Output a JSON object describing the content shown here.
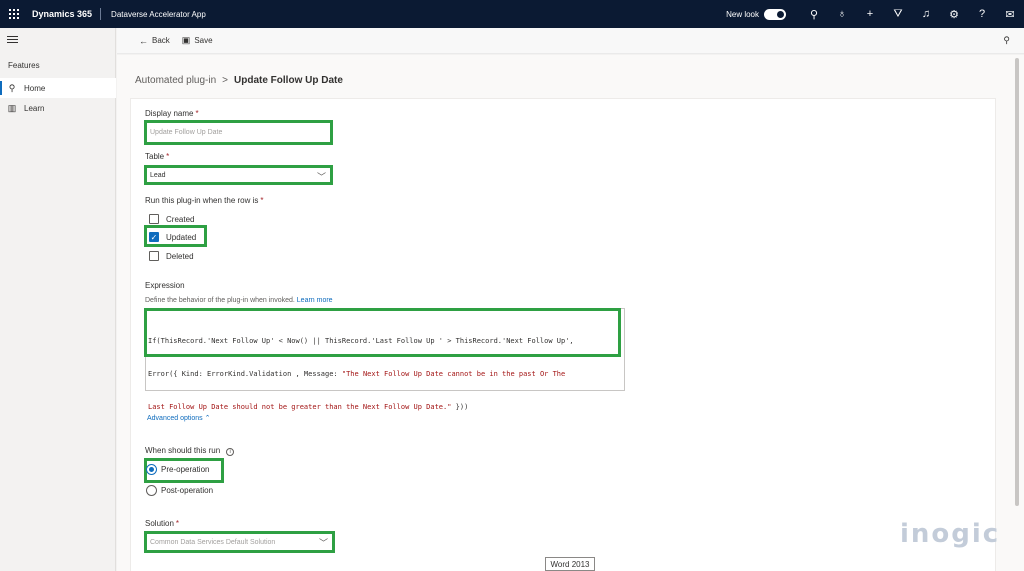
{
  "topbar": {
    "brand": "Dynamics 365",
    "app_name": "Dataverse Accelerator App",
    "new_look_label": "New look",
    "icons": [
      "search-icon",
      "lightbulb-icon",
      "plus-icon",
      "filter-icon",
      "bell-icon",
      "gear-icon",
      "help-icon",
      "feedback-icon"
    ],
    "glyphs": {
      "search": "⚲",
      "lightbulb": "♁",
      "plus": "+",
      "filter": "⛛",
      "bell": "♫",
      "gear": "⚙",
      "help": "?",
      "feedback": "✉"
    }
  },
  "sidebar": {
    "section_title": "Features",
    "items": [
      {
        "label": "Home",
        "icon": "rocket-icon",
        "glyph": "⚲",
        "active": true
      },
      {
        "label": "Learn",
        "icon": "book-icon",
        "glyph": "▥",
        "active": false
      }
    ]
  },
  "commands": {
    "back_label": "Back",
    "back_glyph": "←",
    "save_label": "Save",
    "save_glyph": "▣",
    "pin_glyph": "⚲"
  },
  "breadcrumb": {
    "parent": "Automated plug-in",
    "separator": ">",
    "current": "Update Follow Up Date"
  },
  "form": {
    "display_name": {
      "label": "Display name",
      "required": "*",
      "placeholder": "Update Follow Up Date"
    },
    "table": {
      "label": "Table",
      "required": "*",
      "value": "Lead",
      "chevron": "﹀"
    },
    "run_when": {
      "label": "Run this plug-in when the row is",
      "required": "*",
      "options": [
        {
          "label": "Created",
          "checked": false
        },
        {
          "label": "Updated",
          "checked": true
        },
        {
          "label": "Deleted",
          "checked": false
        }
      ],
      "check_glyph": "✓"
    },
    "expression": {
      "label": "Expression",
      "description": "Define the behavior of the plug-in when invoked.",
      "learn_more": "Learn more",
      "code_line1": "If(ThisRecord.'Next Follow Up' < Now() || ThisRecord.'Last Follow Up ' > ThisRecord.'Next Follow Up',",
      "code_line2_a": "Error({ Kind: ErrorKind.Validation , Message: ",
      "code_line2_b": "\"The Next Follow Up Date cannot be in the past Or The",
      "code_line3_a": "Last Follow Up Date should not be greater than the Next Follow Up Date.\"",
      "code_line3_b": " }))"
    },
    "advanced_options": "Advanced options ⌃",
    "when_run": {
      "label": "When should this run",
      "info_glyph": "i",
      "options": [
        {
          "label": "Pre-operation",
          "selected": true
        },
        {
          "label": "Post-operation",
          "selected": false
        }
      ]
    },
    "solution": {
      "label": "Solution",
      "required": "*",
      "placeholder": "Common Data Services Default Solution",
      "chevron": "﹀"
    }
  },
  "overlay": {
    "word_label": "Word 2013",
    "watermark": "inogic"
  }
}
